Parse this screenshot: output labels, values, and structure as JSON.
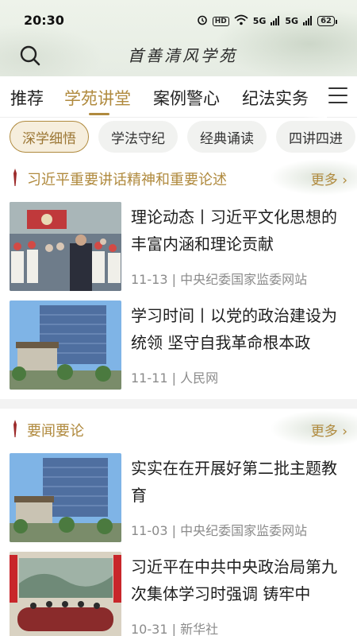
{
  "status": {
    "time": "20:30",
    "hd": "HD",
    "net1": "5G",
    "net2": "5G",
    "battery": "62"
  },
  "header": {
    "logo": "首善清风学苑"
  },
  "tabs": [
    {
      "label": "推荐",
      "active": false
    },
    {
      "label": "学苑讲堂",
      "active": true
    },
    {
      "label": "案例警心",
      "active": false
    },
    {
      "label": "纪法实务",
      "active": false
    }
  ],
  "chips": [
    {
      "label": "深学细悟",
      "active": true
    },
    {
      "label": "学法守纪",
      "active": false
    },
    {
      "label": "经典诵读",
      "active": false
    },
    {
      "label": "四讲四进",
      "active": false
    }
  ],
  "sections": [
    {
      "title": "习近平重要讲话精神和重要论述",
      "more": "更多",
      "items": [
        {
          "title": "理论动态丨习近平文化思想的丰富内涵和理论贡献",
          "date": "11-13",
          "source": "中央纪委国家监委网站"
        },
        {
          "title": "学习时间丨以党的政治建设为统领 坚守自我革命根本政",
          "date": "11-11",
          "source": "人民网"
        }
      ]
    },
    {
      "title": "要闻要论",
      "more": "更多",
      "items": [
        {
          "title": "实实在在开展好第二批主题教育",
          "date": "11-03",
          "source": "中央纪委国家监委网站"
        },
        {
          "title": "习近平在中共中央政治局第九次集体学习时强调 铸牢中",
          "date": "10-31",
          "source": "新华社"
        }
      ]
    }
  ],
  "colors": {
    "accent": "#b08a3e",
    "header_bg": "#e9efe6",
    "chip_bg": "#f1f2f0"
  }
}
